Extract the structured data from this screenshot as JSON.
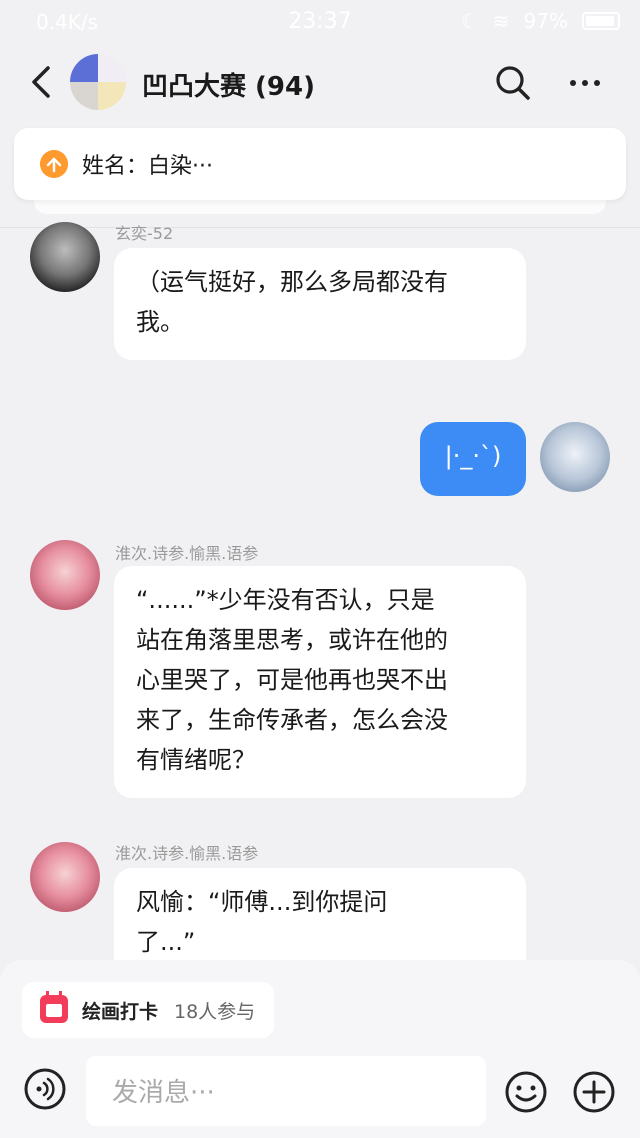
{
  "status_bar": {
    "network_speed": "0.4K/s",
    "time": "23:37",
    "battery": "97%"
  },
  "header": {
    "title": "凹凸大赛 (94)"
  },
  "pinned": {
    "text": "姓名：白染···"
  },
  "messages": [
    {
      "sender": "玄奕-52",
      "text_lines": [
        "（运气挺好，那么多局都没有",
        "我。"
      ]
    },
    {
      "mine": true,
      "text": "|·_·`)"
    },
    {
      "sender": "淮次.诗参.愉黑.语参",
      "text_lines": [
        "“......”*少年没有否认，只是",
        "站在角落里思考，或许在他的",
        "心里哭了，可是他再也哭不出",
        "来了，生命传承者，怎么会没",
        "有情绪呢？"
      ]
    },
    {
      "sender": "淮次.诗参.愉黑.语参",
      "text_lines": [
        "风愉：“师傅...到你提问",
        "了...”"
      ]
    }
  ],
  "bottom": {
    "checkin_label": "绘画打卡",
    "checkin_count": "18人参与",
    "input_placeholder": "发消息···"
  },
  "colors": {
    "accent": "#3d8cf5",
    "pinned_icon": "#ff9a2e",
    "calendar_icon": "#f23c5a"
  },
  "icons": [
    "back-chevron-icon",
    "search-icon",
    "more-icon",
    "pinned-up-icon",
    "calendar-icon",
    "voice-icon",
    "emoji-icon",
    "plus-icon"
  ]
}
